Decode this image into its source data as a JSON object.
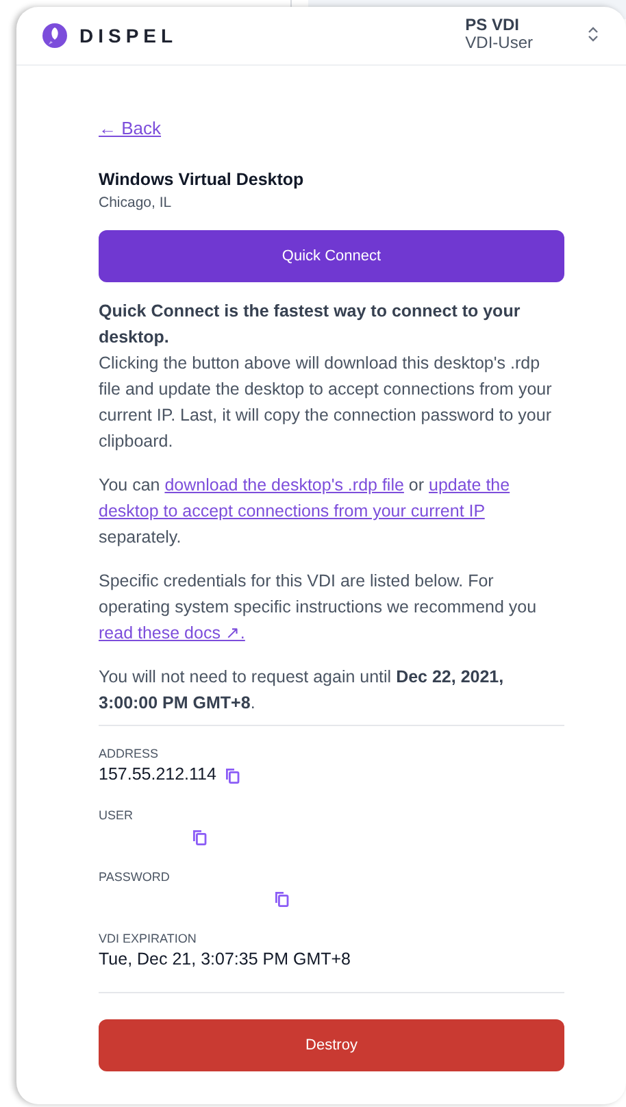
{
  "header": {
    "brand": "DISPEL",
    "account": {
      "name": "PS VDI",
      "role": "VDI-User"
    }
  },
  "back_link": "← Back",
  "desktop": {
    "title": "Windows Virtual Desktop",
    "location": "Chicago, IL"
  },
  "quick_connect_button": "Quick Connect",
  "paragraphs": [
    [
      {
        "kind": "bold",
        "text": "Quick Connect is the fastest way to connect to your desktop."
      },
      {
        "kind": "break"
      },
      {
        "kind": "text",
        "text": "Clicking the button above will download this desktop's .rdp file and update the desktop to accept connections from your current IP. Last, it will copy the connection password to your clipboard."
      }
    ],
    [
      {
        "kind": "text",
        "text": "You can "
      },
      {
        "kind": "link",
        "text": "download the desktop's .rdp file"
      },
      {
        "kind": "text",
        "text": " or "
      },
      {
        "kind": "link",
        "text": "update the"
      },
      {
        "kind": "space"
      },
      {
        "kind": "link",
        "text": "desktop to accept connections from your current IP"
      },
      {
        "kind": "text",
        "text": " separately."
      }
    ],
    [
      {
        "kind": "text",
        "text": "Specific credentials for this VDI are listed below. For operating system specific instructions we recommend you "
      },
      {
        "kind": "link",
        "text": "read these docs ↗."
      }
    ],
    [
      {
        "kind": "text",
        "text": "You will not need to request again until "
      },
      {
        "kind": "bold",
        "text": "Dec 22, 2021, 3:00:00 PM GMT+8"
      },
      {
        "kind": "text",
        "text": "."
      }
    ]
  ],
  "credentials": [
    {
      "label": "ADDRESS",
      "value": "157.55.212.114",
      "copyable": true
    },
    {
      "label": "USER",
      "copyable": true
    },
    {
      "label": "PASSWORD",
      "copyable": true
    },
    {
      "label": "VDI EXPIRATION",
      "value": "Tue, Dec 21, 3:07:35 PM GMT+8",
      "copyable": false
    }
  ],
  "destroy_button": "Destroy"
}
